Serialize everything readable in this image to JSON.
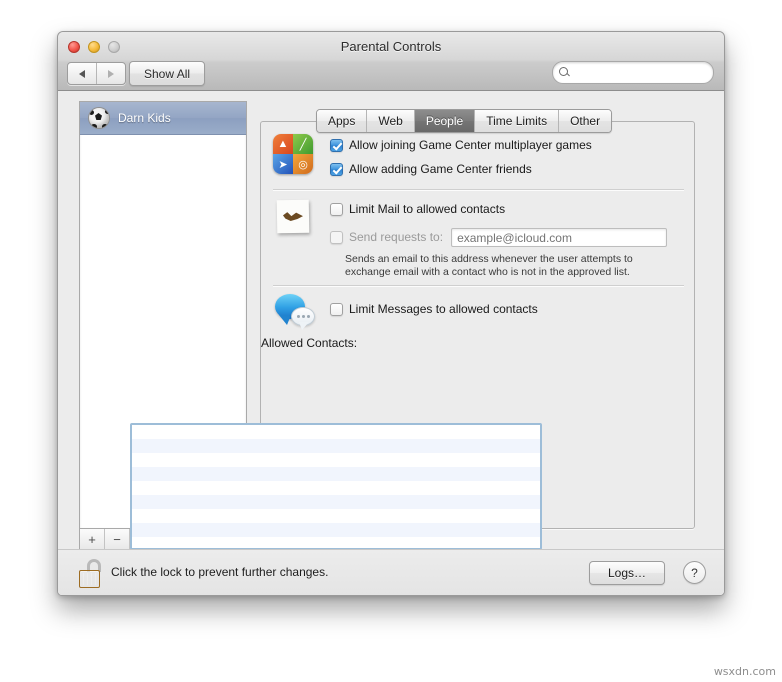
{
  "window": {
    "title": "Parental Controls",
    "traffic_lights": [
      "close",
      "minimize",
      "zoom"
    ],
    "back_label": "◀",
    "forward_label": "▶",
    "show_all_label": "Show All",
    "search": {
      "value": "",
      "placeholder": "",
      "icon": "search-icon"
    }
  },
  "tabs": [
    {
      "label": "Apps",
      "active": false
    },
    {
      "label": "Web",
      "active": false
    },
    {
      "label": "People",
      "active": true
    },
    {
      "label": "Time Limits",
      "active": false
    },
    {
      "label": "Other",
      "active": false
    }
  ],
  "sidebar": {
    "accounts": [
      {
        "name": "Darn Kids",
        "avatar": "soccer-ball-icon",
        "selected": true
      }
    ],
    "footer": {
      "add_label": "+",
      "remove_label": "−",
      "gear_icon": "gear-icon"
    }
  },
  "content": {
    "game_center": {
      "icon": "game-center-icon",
      "options": [
        {
          "label": "Allow joining Game Center multiplayer games",
          "checked": true
        },
        {
          "label": "Allow adding Game Center friends",
          "checked": true
        }
      ]
    },
    "mail": {
      "icon": "mail-icon",
      "limit": {
        "label": "Limit Mail to allowed contacts",
        "checked": false
      },
      "send_requests": {
        "label": "Send requests to:",
        "checked": false,
        "disabled": true
      },
      "email_field": {
        "value": "",
        "placeholder": "example@icloud.com",
        "disabled": true
      },
      "hint_line_1": "Sends an email to this address whenever the user attempts to",
      "hint_line_2": "exchange email with a contact who is not in the approved list."
    },
    "messages": {
      "icon": "messages-icon",
      "limit": {
        "label": "Limit Messages to allowed contacts",
        "checked": false
      }
    },
    "allowed_contacts": {
      "label": "Allowed Contacts:",
      "items": [],
      "row_count": 9,
      "add_label": "+",
      "remove_label": "−"
    }
  },
  "bottom_bar": {
    "lock_icon": "unlocked-padlock-icon",
    "lock_text": "Click the lock to prevent further changes.",
    "logs_label": "Logs…",
    "help_label": "?"
  },
  "watermark": "wsxdn.com",
  "colors": {
    "accent": "#2b7fd0",
    "selection": "#93a5c4",
    "tab_active": "#757575",
    "listbox_border": "#9dbdd8",
    "listbox_alt_row": "#f1f5fd",
    "window_bg": "#ececec"
  }
}
